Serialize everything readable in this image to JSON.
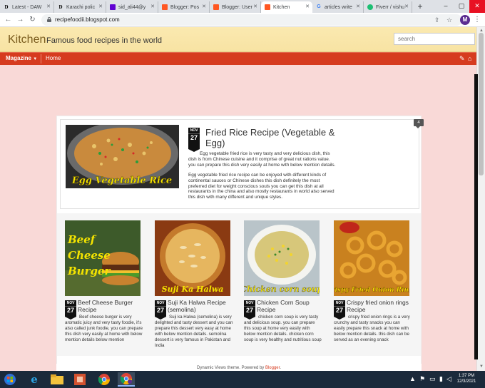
{
  "browser": {
    "tabs": [
      {
        "label": "Latest - DAW",
        "icon": "D"
      },
      {
        "label": "Karachi polic",
        "icon": "D"
      },
      {
        "label": "sid_ali44@y",
        "icon": "mail"
      },
      {
        "label": "Blogger: Pos",
        "icon": "blogger"
      },
      {
        "label": "Blogger: User",
        "icon": "blogger"
      },
      {
        "label": "Kitchen",
        "icon": "blogger",
        "active": true
      },
      {
        "label": "articles write",
        "icon": "google"
      },
      {
        "label": "Fiverr / vishu",
        "icon": "fiverr"
      }
    ],
    "url": "recipefoodii.blogspot.com",
    "profile_initial": "M"
  },
  "blog": {
    "title": "Kitchen",
    "description": "Famous food recipes in the world",
    "search_placeholder": "search",
    "view_label": "Magazine",
    "home_label": "Home"
  },
  "featured": {
    "comment_count": "4",
    "month": "NOV",
    "day": "27",
    "title": "Fried Rice Recipe (Vegetable & Egg)",
    "image_caption": "Egg Vegetable Rice",
    "paragraph_1": "Egg vegetable fried rice is very tasty and very delicious dish, this dish is from Chinese cuisine and it comprise of great nut rations value. you can prepare this dish very easily at home with below mention details.",
    "paragraph_2": "Egg vegetable fried rice recipe can be enjoyed with different kinds of continental sauces or Chinese dishes this dish definitely the most preferred diet for weight conscious souls you can get this dish at all restaurants in the china and also mostly restaurants in world also served this dish with many different and unique styles."
  },
  "cards": [
    {
      "month": "NOV",
      "day": "27",
      "title": "Beef Cheese Burger Recipe",
      "image_caption": "Beef Cheese Burger",
      "body": "Beef cheese burger is very aromatic juicy and very tasty foodie, it's also called junk foodie, you can prepare this dish very easily at home with below mention details below mention"
    },
    {
      "month": "NOV",
      "day": "27",
      "title": "Suji Ka Halwa Recipe (semolina)",
      "image_caption": "Suji Ka Halwa",
      "body": "Suji ka Halwa (semolina) is very delighted and tasty dessert and you can prepare this dessert very easy at home with below mention details. semolina dessert is very famous in Pakistan and India"
    },
    {
      "month": "NOV",
      "day": "27",
      "title": "Chicken Corn Soup Recipe",
      "image_caption": "Chicken corn soup",
      "body": "chicken corn soup is very tasty and delicious soup. you can prepare this soup at home very easily with below mention details. chicken corn soup is very healthy and nutritious soup"
    },
    {
      "month": "NOV",
      "day": "27",
      "title": "Crispy fried onion rings Recipe",
      "image_caption": "Crispy Fried Onion Rings",
      "body": "crispy fried onion rings is a very crunchy and tasty snacks you can easily prepare this snack at home with below mention details. this dish can be served as an evening snack"
    }
  ],
  "footer": {
    "prefix": "Dynamic Views theme. Powered by ",
    "link": "Blogger",
    "suffix": "."
  },
  "taskbar": {
    "time": "1:37 PM",
    "date": "12/3/2021"
  },
  "colors": {
    "header_bg": "#fbe9b0",
    "nav_bg": "#d63b1f",
    "page_bg": "#f9d9d7",
    "caption_yellow": "#f5e400"
  }
}
